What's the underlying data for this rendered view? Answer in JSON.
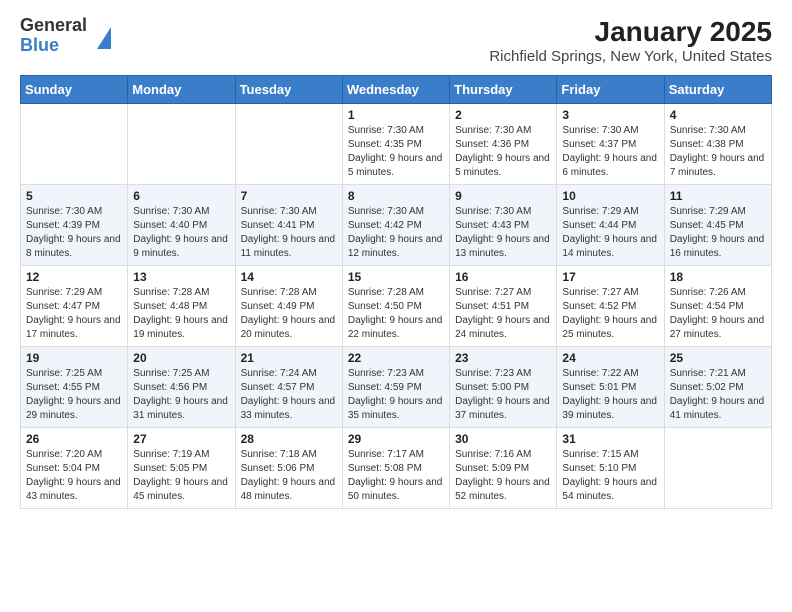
{
  "header": {
    "logo_general": "General",
    "logo_blue": "Blue",
    "title": "January 2025",
    "subtitle": "Richfield Springs, New York, United States"
  },
  "weekdays": [
    "Sunday",
    "Monday",
    "Tuesday",
    "Wednesday",
    "Thursday",
    "Friday",
    "Saturday"
  ],
  "weeks": [
    [
      {
        "day": "",
        "content": ""
      },
      {
        "day": "",
        "content": ""
      },
      {
        "day": "",
        "content": ""
      },
      {
        "day": "1",
        "content": "Sunrise: 7:30 AM\nSunset: 4:35 PM\nDaylight: 9 hours and 5 minutes."
      },
      {
        "day": "2",
        "content": "Sunrise: 7:30 AM\nSunset: 4:36 PM\nDaylight: 9 hours and 5 minutes."
      },
      {
        "day": "3",
        "content": "Sunrise: 7:30 AM\nSunset: 4:37 PM\nDaylight: 9 hours and 6 minutes."
      },
      {
        "day": "4",
        "content": "Sunrise: 7:30 AM\nSunset: 4:38 PM\nDaylight: 9 hours and 7 minutes."
      }
    ],
    [
      {
        "day": "5",
        "content": "Sunrise: 7:30 AM\nSunset: 4:39 PM\nDaylight: 9 hours and 8 minutes."
      },
      {
        "day": "6",
        "content": "Sunrise: 7:30 AM\nSunset: 4:40 PM\nDaylight: 9 hours and 9 minutes."
      },
      {
        "day": "7",
        "content": "Sunrise: 7:30 AM\nSunset: 4:41 PM\nDaylight: 9 hours and 11 minutes."
      },
      {
        "day": "8",
        "content": "Sunrise: 7:30 AM\nSunset: 4:42 PM\nDaylight: 9 hours and 12 minutes."
      },
      {
        "day": "9",
        "content": "Sunrise: 7:30 AM\nSunset: 4:43 PM\nDaylight: 9 hours and 13 minutes."
      },
      {
        "day": "10",
        "content": "Sunrise: 7:29 AM\nSunset: 4:44 PM\nDaylight: 9 hours and 14 minutes."
      },
      {
        "day": "11",
        "content": "Sunrise: 7:29 AM\nSunset: 4:45 PM\nDaylight: 9 hours and 16 minutes."
      }
    ],
    [
      {
        "day": "12",
        "content": "Sunrise: 7:29 AM\nSunset: 4:47 PM\nDaylight: 9 hours and 17 minutes."
      },
      {
        "day": "13",
        "content": "Sunrise: 7:28 AM\nSunset: 4:48 PM\nDaylight: 9 hours and 19 minutes."
      },
      {
        "day": "14",
        "content": "Sunrise: 7:28 AM\nSunset: 4:49 PM\nDaylight: 9 hours and 20 minutes."
      },
      {
        "day": "15",
        "content": "Sunrise: 7:28 AM\nSunset: 4:50 PM\nDaylight: 9 hours and 22 minutes."
      },
      {
        "day": "16",
        "content": "Sunrise: 7:27 AM\nSunset: 4:51 PM\nDaylight: 9 hours and 24 minutes."
      },
      {
        "day": "17",
        "content": "Sunrise: 7:27 AM\nSunset: 4:52 PM\nDaylight: 9 hours and 25 minutes."
      },
      {
        "day": "18",
        "content": "Sunrise: 7:26 AM\nSunset: 4:54 PM\nDaylight: 9 hours and 27 minutes."
      }
    ],
    [
      {
        "day": "19",
        "content": "Sunrise: 7:25 AM\nSunset: 4:55 PM\nDaylight: 9 hours and 29 minutes."
      },
      {
        "day": "20",
        "content": "Sunrise: 7:25 AM\nSunset: 4:56 PM\nDaylight: 9 hours and 31 minutes."
      },
      {
        "day": "21",
        "content": "Sunrise: 7:24 AM\nSunset: 4:57 PM\nDaylight: 9 hours and 33 minutes."
      },
      {
        "day": "22",
        "content": "Sunrise: 7:23 AM\nSunset: 4:59 PM\nDaylight: 9 hours and 35 minutes."
      },
      {
        "day": "23",
        "content": "Sunrise: 7:23 AM\nSunset: 5:00 PM\nDaylight: 9 hours and 37 minutes."
      },
      {
        "day": "24",
        "content": "Sunrise: 7:22 AM\nSunset: 5:01 PM\nDaylight: 9 hours and 39 minutes."
      },
      {
        "day": "25",
        "content": "Sunrise: 7:21 AM\nSunset: 5:02 PM\nDaylight: 9 hours and 41 minutes."
      }
    ],
    [
      {
        "day": "26",
        "content": "Sunrise: 7:20 AM\nSunset: 5:04 PM\nDaylight: 9 hours and 43 minutes."
      },
      {
        "day": "27",
        "content": "Sunrise: 7:19 AM\nSunset: 5:05 PM\nDaylight: 9 hours and 45 minutes."
      },
      {
        "day": "28",
        "content": "Sunrise: 7:18 AM\nSunset: 5:06 PM\nDaylight: 9 hours and 48 minutes."
      },
      {
        "day": "29",
        "content": "Sunrise: 7:17 AM\nSunset: 5:08 PM\nDaylight: 9 hours and 50 minutes."
      },
      {
        "day": "30",
        "content": "Sunrise: 7:16 AM\nSunset: 5:09 PM\nDaylight: 9 hours and 52 minutes."
      },
      {
        "day": "31",
        "content": "Sunrise: 7:15 AM\nSunset: 5:10 PM\nDaylight: 9 hours and 54 minutes."
      },
      {
        "day": "",
        "content": ""
      }
    ]
  ]
}
